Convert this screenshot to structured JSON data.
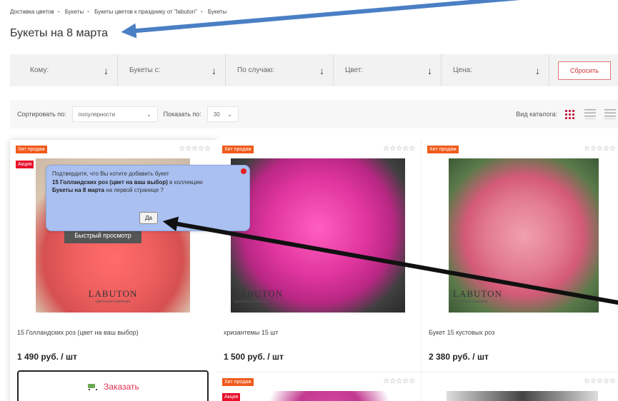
{
  "breadcrumb": {
    "items": [
      "Доставка цветов",
      "Букеты",
      "Букеты цветов к празднику от \"labuton\"",
      "Букеты"
    ]
  },
  "page_title": "Букеты на 8 марта",
  "filters": {
    "items": [
      {
        "label": "Кому:"
      },
      {
        "label": "Букеты с:"
      },
      {
        "label": "По случаю:"
      },
      {
        "label": "Цвет:"
      },
      {
        "label": "Цена:"
      }
    ],
    "arrow": "↓",
    "reset_label": "Сбросить"
  },
  "sort_bar": {
    "sort_label": "Сортировать по:",
    "sort_value": "популярности",
    "show_label": "Показать по:",
    "show_value": "30",
    "view_label": "Вид каталога:"
  },
  "icons": {
    "dropdown": "⌄",
    "stars": "☆☆☆☆☆"
  },
  "badges": {
    "hit": "Хит продаж",
    "sale": "Акция"
  },
  "logo": {
    "name": "LABUTON",
    "tagline": "Цветочная компания"
  },
  "products": [
    {
      "name": "15 Голландских роз (цвет на ваш выбор)",
      "price": "1 490 руб. / шт"
    },
    {
      "name": "хризантемы 15 шт",
      "price": "1 500 руб. / шт"
    },
    {
      "name": "Букет 15 кустовых роз",
      "price": "2 380 руб. / шт"
    }
  ],
  "quick_view_label": "Быстрый просмотр",
  "order_label": "Заказать",
  "popup": {
    "line1": "Подтвердите, что Вы хотите добавить букет",
    "bold_product": "15 Голландских роз (цвет на ваш выбор)",
    "mid": " в коллекцию",
    "bold_collection": "Букеты на 8 марта",
    "tail": " на первой странице ?",
    "ok_label": "Да"
  },
  "colors": {
    "accent": "#c0143c",
    "hit_badge": "#f05a1a",
    "sale_badge": "#e8102a",
    "popup_bg": "#a9c0f0",
    "annotation_blue": "#4a7fc4"
  }
}
